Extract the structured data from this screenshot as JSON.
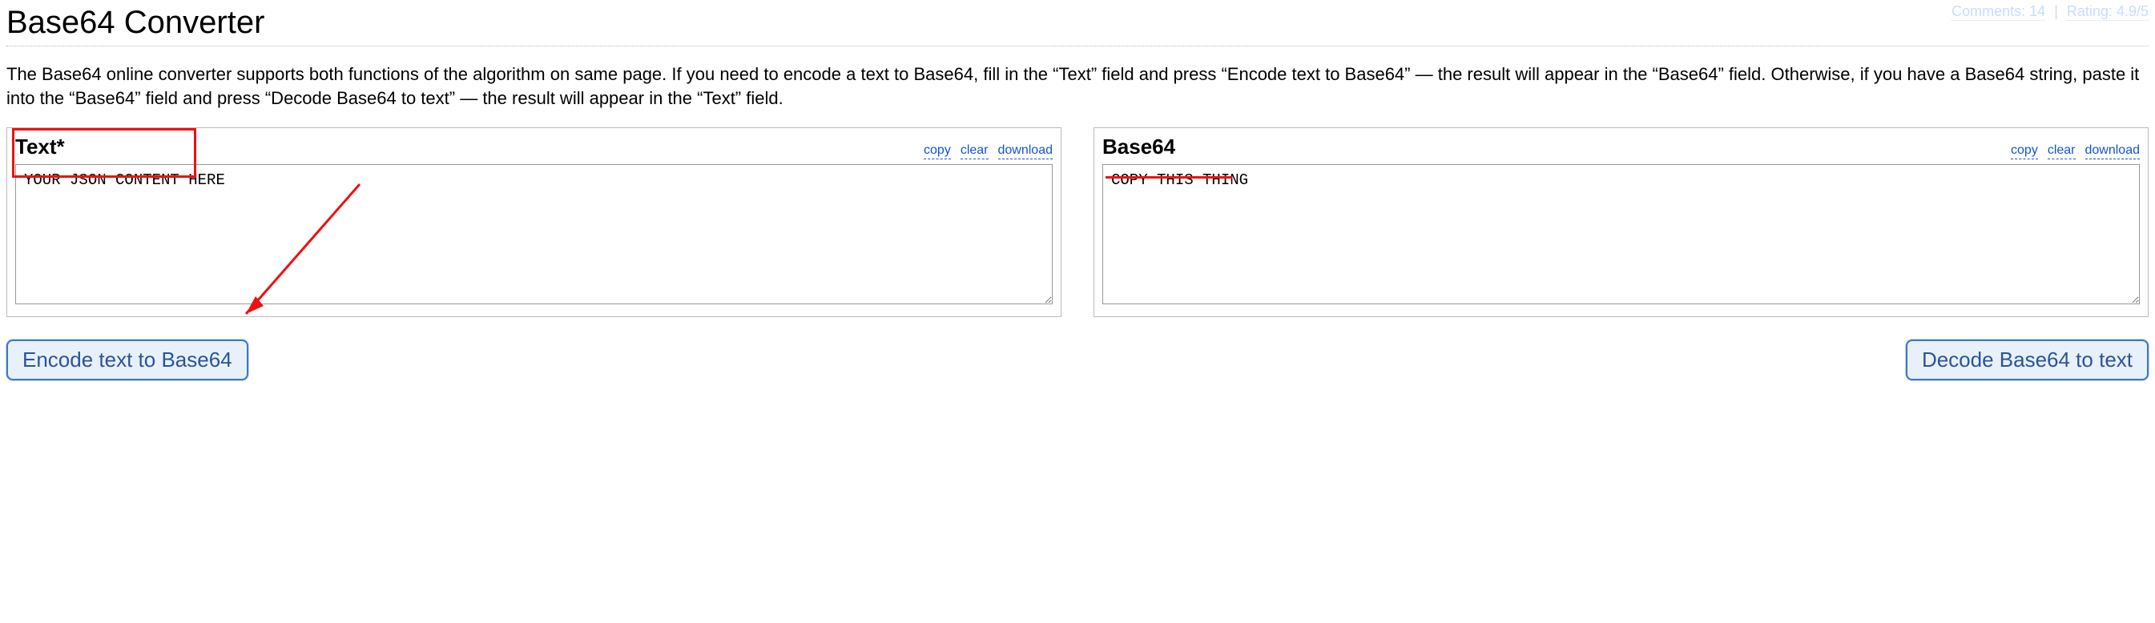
{
  "meta": {
    "comments_label": "Comments:",
    "comments_count": "14",
    "rating_label": "Rating:",
    "rating_value": "4.9/5"
  },
  "title": "Base64 Converter",
  "description": "The Base64 online converter supports both functions of the algorithm on same page. If you need to encode a text to Base64, fill in the “Text” field and press “Encode text to Base64” — the result will appear in the “Base64” field. Otherwise, if you have a Base64 string, paste it into the “Base64” field and press “Decode Base64 to text” — the result will appear in the “Text” field.",
  "panels": {
    "text": {
      "title": "Text*",
      "actions": {
        "copy": "copy",
        "clear": "clear",
        "download": "download"
      },
      "value": "YOUR JSON CONTENT HERE"
    },
    "base64": {
      "title": "Base64",
      "actions": {
        "copy": "copy",
        "clear": "clear",
        "download": "download"
      },
      "value": "COPY THIS THING"
    }
  },
  "buttons": {
    "encode": "Encode text to Base64",
    "decode": "Decode Base64 to text"
  }
}
